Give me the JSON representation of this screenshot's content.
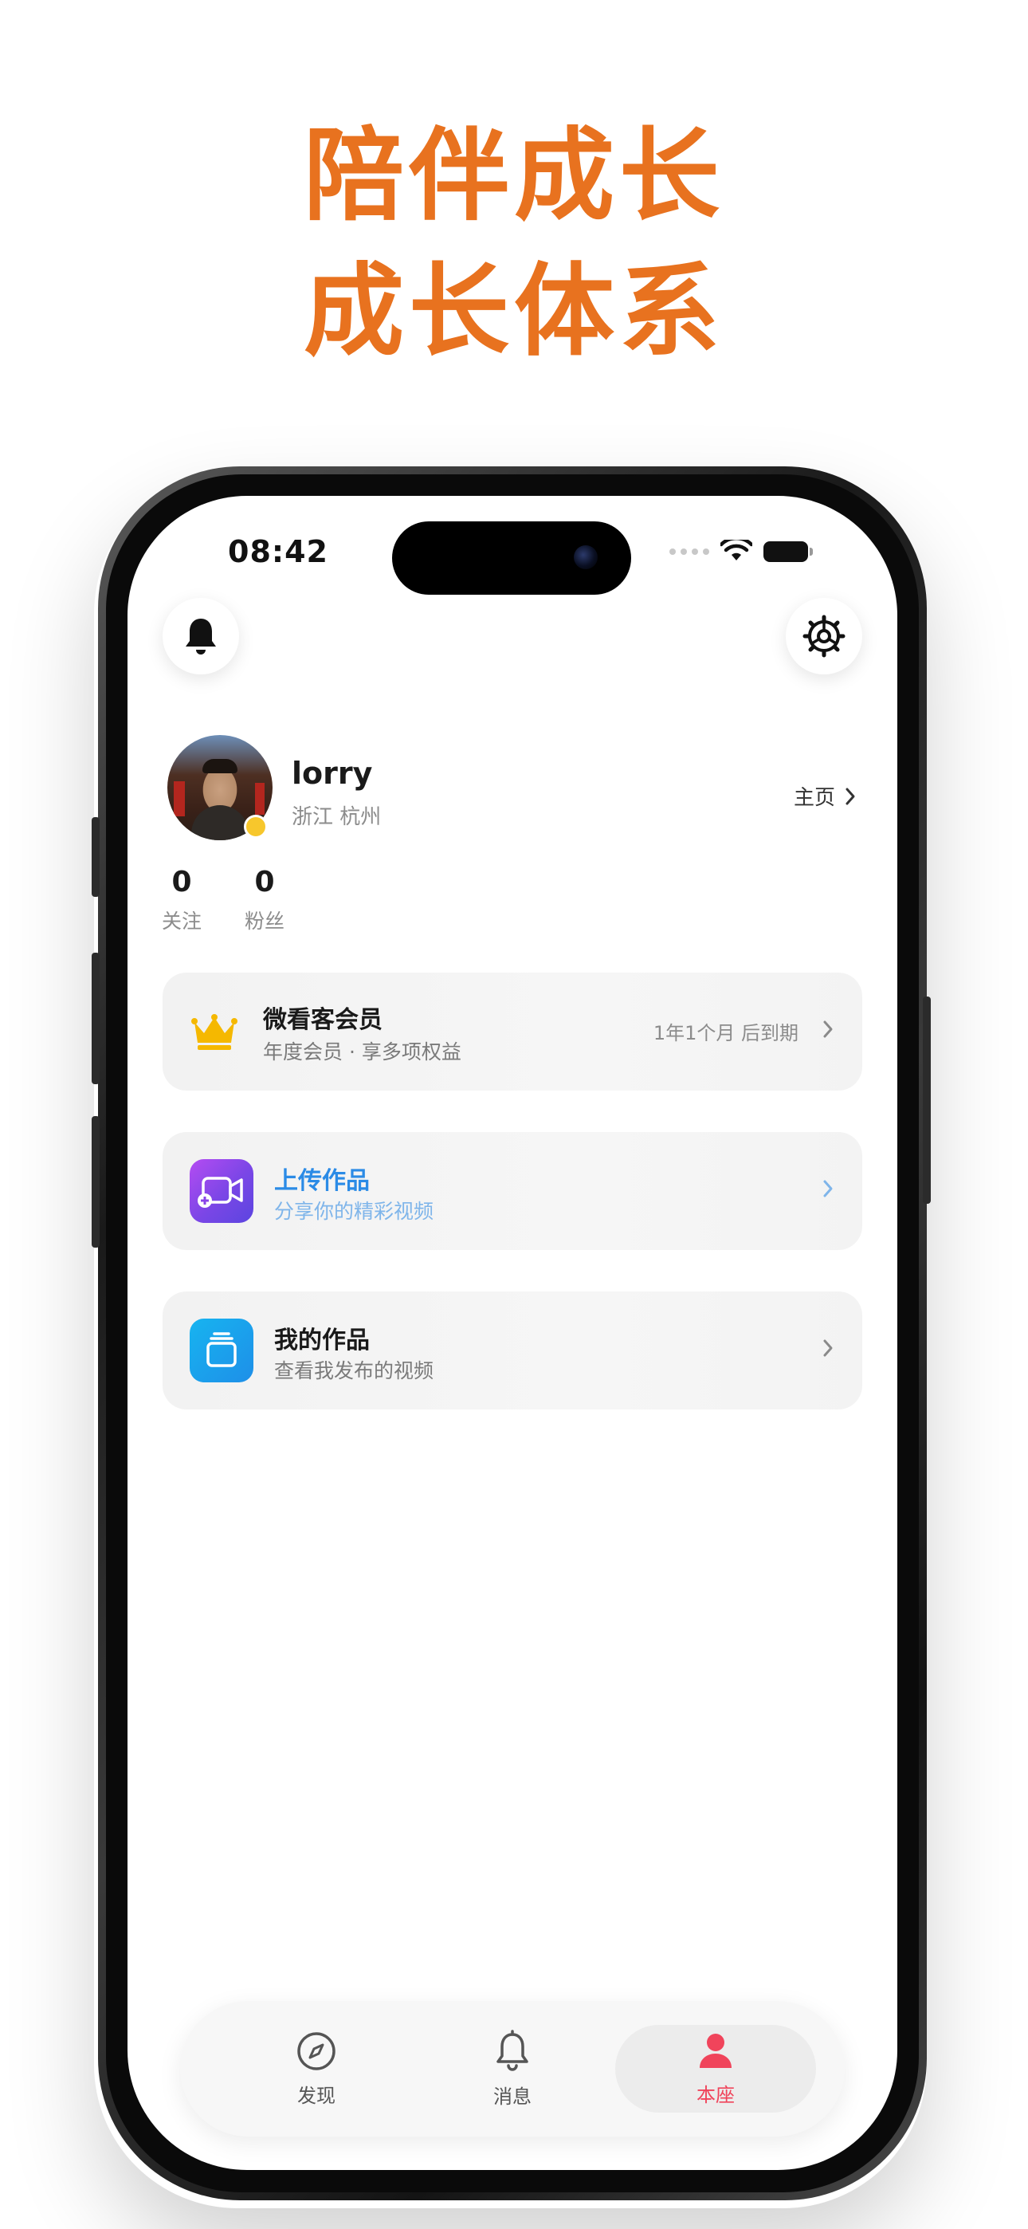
{
  "promo": {
    "line1": "陪伴成长",
    "line2": "成长体系"
  },
  "status_bar": {
    "time": "08:42"
  },
  "profile": {
    "name": "lorry",
    "location": "浙江 杭州",
    "home_link": "主页",
    "stats": [
      {
        "value": "0",
        "label": "关注"
      },
      {
        "value": "0",
        "label": "粉丝"
      }
    ]
  },
  "cards": {
    "membership": {
      "title": "微看客会员",
      "subtitle": "年度会员 · 享多项权益",
      "expiry": "1年1个月 后到期"
    },
    "upload": {
      "title": "上传作品",
      "subtitle": "分享你的精彩视频"
    },
    "my_works": {
      "title": "我的作品",
      "subtitle": "查看我发布的视频"
    }
  },
  "tabbar": {
    "tabs": [
      {
        "label": "发现",
        "icon": "compass-icon"
      },
      {
        "label": "消息",
        "icon": "bell-icon"
      },
      {
        "label": "本座",
        "icon": "person-icon",
        "active": true
      }
    ]
  },
  "colors": {
    "promo_orange": "#e8721f",
    "active_tab": "#f0445b",
    "upload_blue": "#2b8be6",
    "crown_gold": "#f5b800"
  }
}
